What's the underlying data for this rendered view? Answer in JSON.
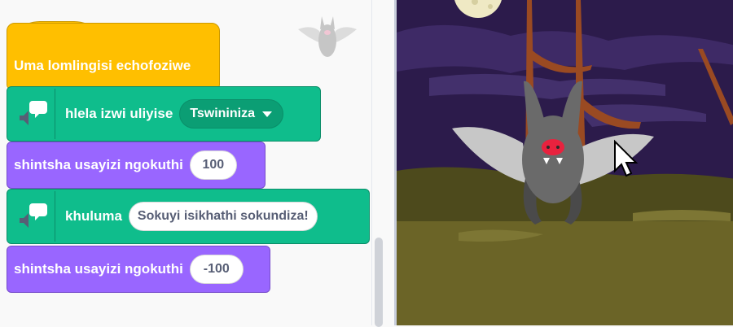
{
  "code_area": {
    "sprite_name_hidden": "",
    "blocks": {
      "hat": {
        "label": "Uma lomlingisi echofoziwe"
      },
      "set_voice": {
        "label": "hlela izwi uliyise",
        "value": "Tswininiza"
      },
      "change_size_1": {
        "label": "shintsha usayizi ngokuthi",
        "value": "100"
      },
      "speak": {
        "label": "khuluma",
        "value": "Sokuyi isikhathi sokundiza!"
      },
      "change_size_2": {
        "label": "shintsha usayizi ngokuthi",
        "value": "-100"
      }
    }
  },
  "colors": {
    "events": "#ffbf00",
    "extension": "#0fbd8c",
    "looks": "#9966ff",
    "night_sky": "#2a1a4a",
    "ground": "#6b6427"
  },
  "icons": [
    "speech-bubble-speaker-icon",
    "chevron-down-icon",
    "bat-sprite",
    "mouse-cursor-icon"
  ]
}
